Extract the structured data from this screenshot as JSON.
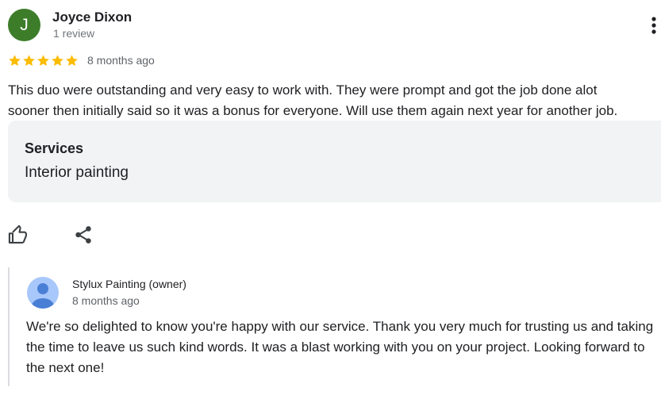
{
  "review": {
    "avatar_initial": "J",
    "avatar_color": "#3d7d2a",
    "reviewer_name": "Joyce Dixon",
    "review_count": "1 review",
    "more_icon": "more-vert-icon",
    "rating": 5,
    "rating_max": 5,
    "star_color": "#fbbc04",
    "date": "8 months ago",
    "text_line_1": "This duo were outstanding and very easy to work with. They were prompt and got the job done alot",
    "text_line_2": "sooner then initially said so it was a bonus for everyone. Will use them again next year for another job.",
    "services": {
      "heading": "Services",
      "value": "Interior painting"
    },
    "actions": {
      "like_icon": "thumb-up-icon",
      "share_icon": "share-icon"
    }
  },
  "owner_reply": {
    "avatar_icon": "person-avatar-icon",
    "name": "Stylux Painting (owner)",
    "date": "8 months ago",
    "text": "We're so delighted to know you're happy with our service. Thank you very much for trusting us and taking the time to leave us such kind words. It was a blast working with you on your project. Looking forward to the next one!"
  }
}
